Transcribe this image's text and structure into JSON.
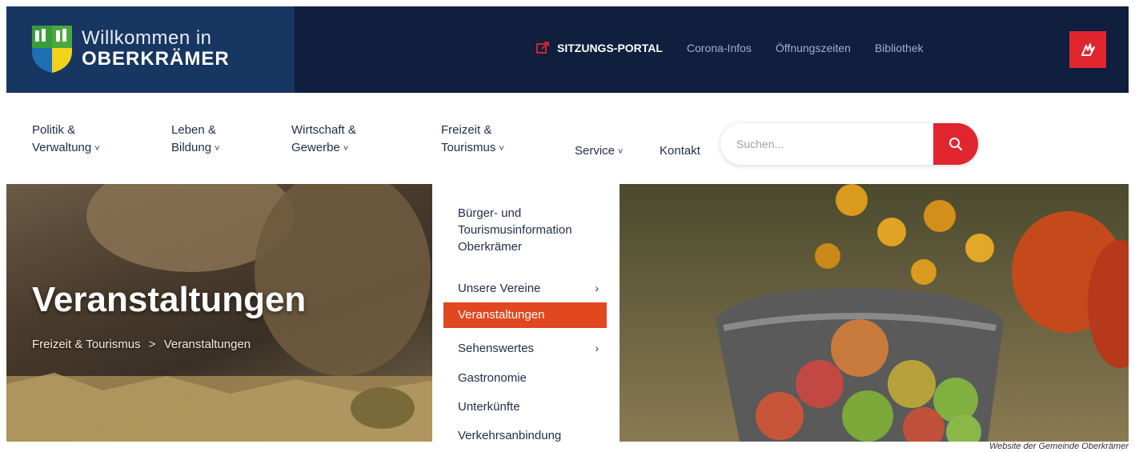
{
  "brand": {
    "line1": "Willkommen in",
    "line2": "OBERKRÄMER"
  },
  "utility_nav": {
    "portal": "SITZUNGS-PORTAL",
    "links": [
      "Corona-Infos",
      "Öffnungszeiten",
      "Bibliothek"
    ]
  },
  "main_nav": [
    {
      "line1": "Politik &",
      "line2": "Verwaltung"
    },
    {
      "line1": "Leben &",
      "line2": "Bildung"
    },
    {
      "line1": "Wirtschaft &",
      "line2": "Gewerbe"
    },
    {
      "line1": "Freizeit &",
      "line2": "Tourismus"
    },
    {
      "line1": "",
      "line2": "Service"
    },
    {
      "line1": "",
      "line2": "Kontakt"
    }
  ],
  "search": {
    "placeholder": "Suchen..."
  },
  "hero": {
    "title": "Veranstaltungen",
    "breadcrumb": [
      "Freizeit & Tourismus",
      ">",
      "Veranstaltungen"
    ]
  },
  "dropdown": {
    "items": [
      {
        "label_lines": [
          "Bürger- und",
          "Tourismusinformation",
          "Oberkrämer"
        ],
        "has_submenu": false,
        "active": false
      },
      {
        "label": "Unsere Vereine",
        "has_submenu": true,
        "active": false
      },
      {
        "label": "Veranstaltungen",
        "has_submenu": false,
        "active": true
      },
      {
        "label": "Sehenswertes",
        "has_submenu": true,
        "active": false
      },
      {
        "label": "Gastronomie",
        "has_submenu": false,
        "active": false
      },
      {
        "label": "Unterkünfte",
        "has_submenu": false,
        "active": false
      },
      {
        "label": "Verkehrsanbindung",
        "has_submenu": false,
        "active": false
      }
    ]
  },
  "caption": "Website der Gemeinde Oberkrämer",
  "colors": {
    "topbar": "#0f1f3d",
    "brand_panel": "#173762",
    "accent_red": "#e1252f",
    "active_orange": "#e1481f",
    "nav_text": "#1e2d4d"
  },
  "icons": {
    "portal": "external-link-icon",
    "accessibility": "sign-language-icon",
    "search": "search-icon",
    "submenu": "chevron-right-icon",
    "nav": "chevron-down-icon"
  }
}
